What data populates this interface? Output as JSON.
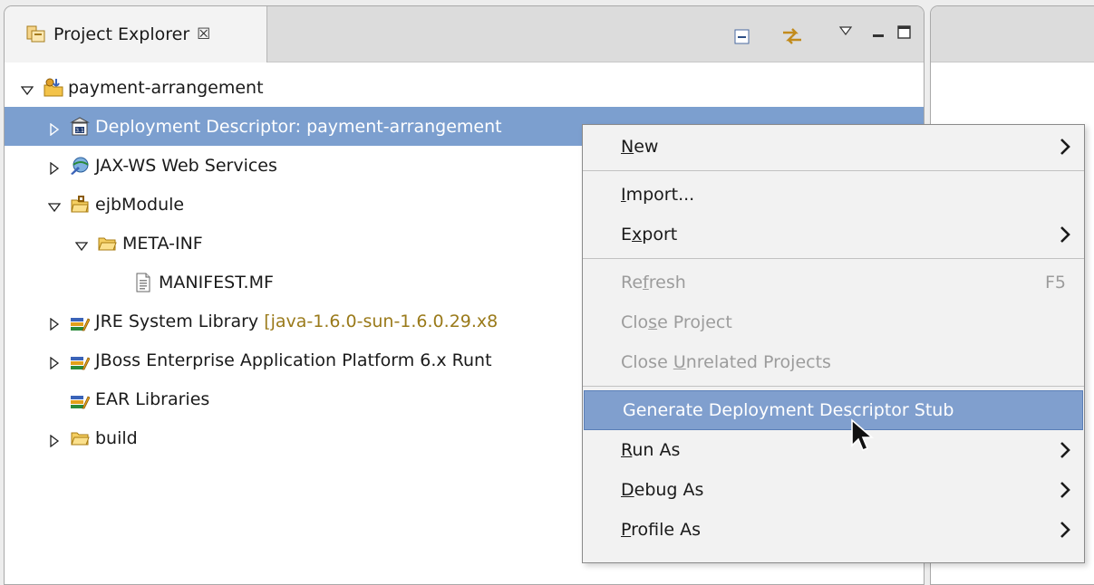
{
  "view": {
    "title": "Project Explorer",
    "close_glyph": "☒"
  },
  "toolbar": {
    "icons": [
      "collapse-all-icon",
      "link-with-editor-icon",
      "view-menu-icon",
      "minimize-icon",
      "maximize-icon"
    ]
  },
  "tree": [
    {
      "label": "payment-arrangement",
      "expanded": true,
      "icon": "ejb-project-icon"
    },
    {
      "label": "Deployment Descriptor: payment-arrangement",
      "expanded": false,
      "icon": "deployment-descriptor-icon",
      "selected": true
    },
    {
      "label": "JAX-WS Web Services",
      "expanded": false,
      "icon": "web-services-icon"
    },
    {
      "label": "ejbModule",
      "expanded": true,
      "icon": "source-folder-icon"
    },
    {
      "label": "META-INF",
      "expanded": true,
      "icon": "folder-icon"
    },
    {
      "label": "MANIFEST.MF",
      "icon": "file-icon"
    },
    {
      "label": "JRE System Library",
      "decoration": "[java-1.6.0-sun-1.6.0.29.x8",
      "expanded": false,
      "icon": "library-icon"
    },
    {
      "label": "JBoss Enterprise Application Platform 6.x Runt",
      "expanded": false,
      "icon": "library-icon"
    },
    {
      "label": "EAR Libraries",
      "icon": "library-icon"
    },
    {
      "label": "build",
      "expanded": false,
      "icon": "folder-icon"
    }
  ],
  "menu": {
    "new": {
      "pre": "",
      "mn": "N",
      "post": "ew"
    },
    "import": {
      "pre": "",
      "mn": "I",
      "post": "mport..."
    },
    "export": {
      "pre": "E",
      "mn": "x",
      "post": "port"
    },
    "refresh": {
      "pre": "Re",
      "mn": "f",
      "post": "resh",
      "accel": "F5"
    },
    "close_project": {
      "pre": "Clo",
      "mn": "s",
      "post": "e Project"
    },
    "close_unrelated": {
      "pre": "Close ",
      "mn": "U",
      "post": "nrelated Projects"
    },
    "generate": {
      "label": "Generate Deployment Descriptor Stub"
    },
    "run_as": {
      "pre": "",
      "mn": "R",
      "post": "un As"
    },
    "debug_as": {
      "pre": "",
      "mn": "D",
      "post": "ebug As"
    },
    "profile_as": {
      "pre": "",
      "mn": "P",
      "post": "rofile As"
    }
  },
  "colors": {
    "selection": "#7c9fcf",
    "menu_highlight": "#809fce",
    "decoration": "#9a7a1a",
    "disabled": "#9c9c9c"
  }
}
